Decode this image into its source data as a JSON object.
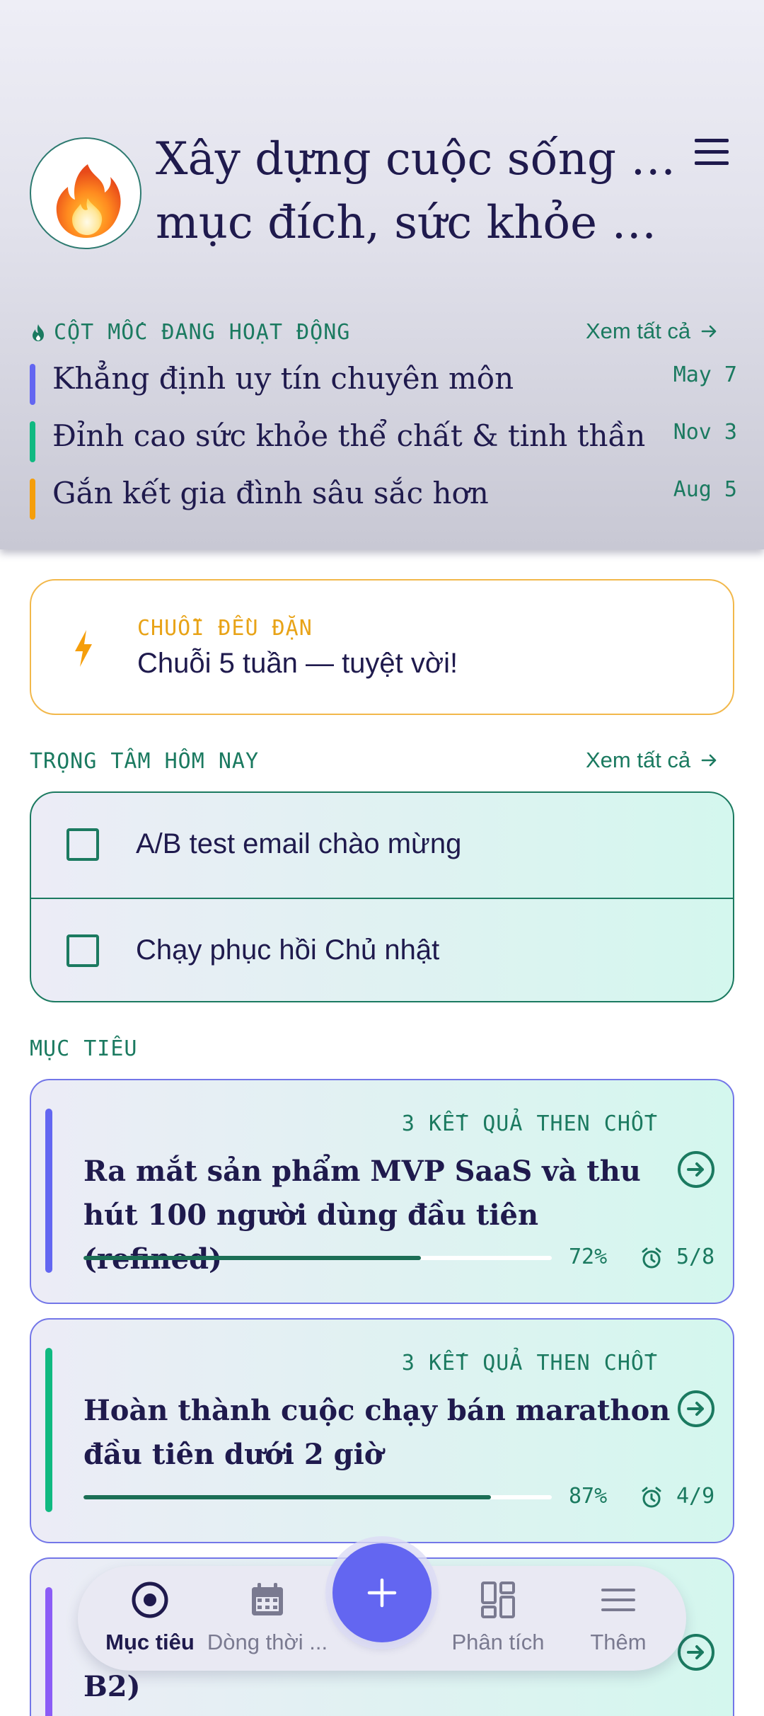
{
  "header": {
    "title_line1": "Xây dựng cuộc sống có",
    "title_line2": "mục đích, sức khỏe và t...",
    "avatar_icon": "fire-icon",
    "menu_icon": "hamburger-menu-icon"
  },
  "milestones": {
    "label": "CỘT MỐC ĐANG HOẠT ĐỘNG",
    "see_all": "Xem tất cả",
    "items": [
      {
        "title": "Khẳng định uy tín chuyên môn",
        "date": "May 7",
        "color": "#6366f1"
      },
      {
        "title": "Đỉnh cao sức khỏe thể chất & tinh thần",
        "date": "Nov 3",
        "color": "#10b981"
      },
      {
        "title": "Gắn kết gia đình sâu sắc hơn",
        "date": "Aug 5",
        "color": "#f59e0b"
      }
    ]
  },
  "streak": {
    "label": "CHUỖI ĐỀU ĐẶN",
    "text": "Chuỗi 5 tuần — tuyệt vời!",
    "accent": "#f59e0b"
  },
  "focus": {
    "label": "TRỌNG TÂM HÔM NAY",
    "see_all": "Xem tất cả",
    "items": [
      {
        "text": "A/B test email chào mừng",
        "checked": false
      },
      {
        "text": "Chạy phục hồi Chủ nhật",
        "checked": false
      }
    ]
  },
  "goals": {
    "label": "MỤC TIÊU",
    "items": [
      {
        "key_results": "3 KẾT QUẢ THEN CHỐT",
        "title": "Ra mắt sản phẩm MVP SaaS và thu hút 100 người dùng đầu tiên (refined)",
        "progress": 0.72,
        "progress_label": "72%",
        "count": "5/8",
        "color": "#6366f1"
      },
      {
        "key_results": "3 KẾT QUẢ THEN CHỐT",
        "title": "Hoàn thành cuộc chạy bán marathon đầu tiên dưới 2 giờ",
        "progress": 0.87,
        "progress_label": "87%",
        "count": "4/9",
        "color": "#10b981"
      },
      {
        "title_fragment": "B2)",
        "color": "#8b5cf6"
      }
    ]
  },
  "nav": {
    "items": [
      {
        "label": "Mục tiêu",
        "icon": "target-icon",
        "active": true
      },
      {
        "label": "Dòng thời ...",
        "icon": "calendar-icon",
        "active": false
      },
      {
        "label": "Phân tích",
        "icon": "dashboard-icon",
        "active": false
      },
      {
        "label": "Thêm",
        "icon": "menu-icon",
        "active": false
      }
    ],
    "fab_icon": "plus-icon"
  },
  "colors": {
    "primary": "#6366f1",
    "teal": "#1b7a60",
    "ink": "#1f1a4d",
    "amber": "#f59e0b"
  }
}
